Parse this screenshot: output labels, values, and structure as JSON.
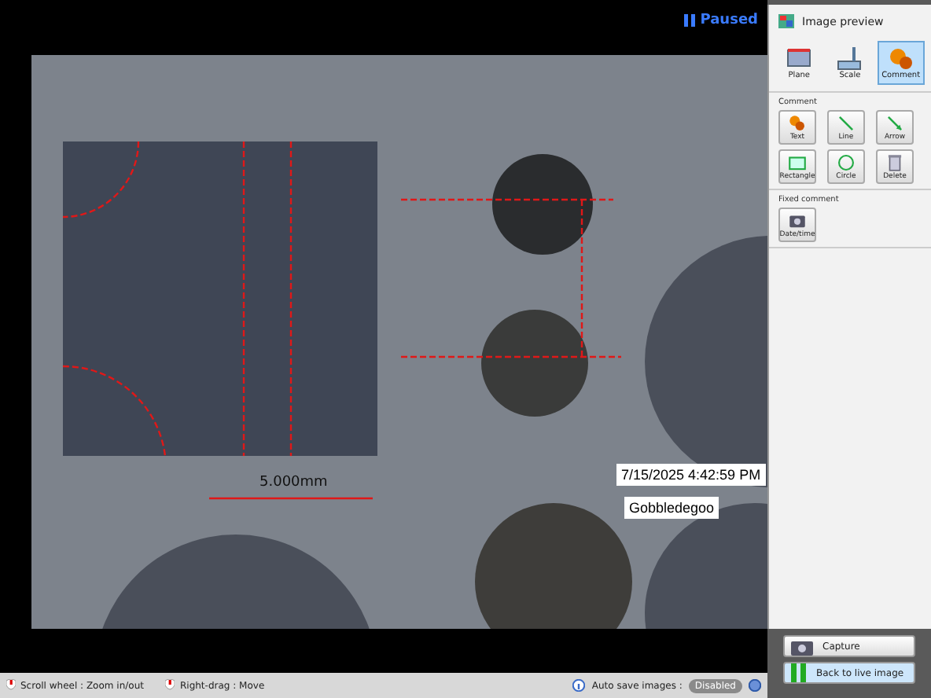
{
  "viewer": {
    "status": "Paused",
    "scale_label": "5.000mm",
    "overlay_comments": [
      {
        "kind": "date",
        "text": "7/15/2025 4:42:59 PM"
      },
      {
        "kind": "note",
        "text": "Gobbledegoo"
      }
    ]
  },
  "status_bar": {
    "hints": [
      "Scroll wheel : Zoom in/out",
      "Right-drag : Move"
    ],
    "auto_save_label": "Auto save images :",
    "auto_save_value": "Disabled"
  },
  "panel": {
    "title": "Image preview",
    "modes": [
      {
        "label": "Plane",
        "selected": false
      },
      {
        "label": "Scale",
        "selected": false
      },
      {
        "label": "Comment",
        "selected": true
      }
    ],
    "sections": [
      {
        "title": "Comment",
        "tools": [
          "Text",
          "Line",
          "Arrow",
          "Rectangle",
          "Circle",
          "Delete"
        ]
      },
      {
        "title": "Fixed comment",
        "tools": [
          "Date/time"
        ]
      }
    ],
    "buttons": [
      {
        "kind": "capture",
        "label": "Capture"
      },
      {
        "kind": "live",
        "label": "Back to live image"
      }
    ]
  }
}
